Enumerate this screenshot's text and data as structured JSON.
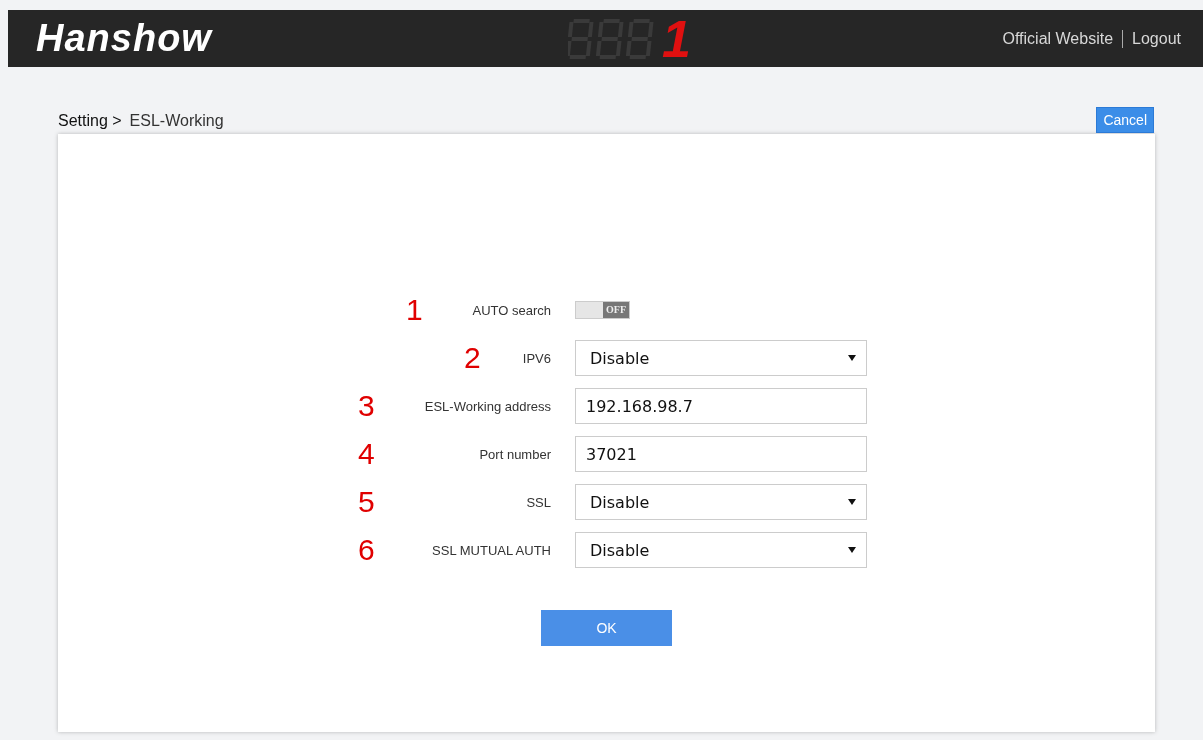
{
  "header": {
    "logo": "Hanshow",
    "display_digit": "1",
    "links": [
      "Official Website",
      "Logout"
    ]
  },
  "breadcrumb": [
    "Setting >",
    "ESL-Working"
  ],
  "cancel_button": "Cancel",
  "form": [
    {
      "marker": "1",
      "label": "AUTO search",
      "kind": "toggle",
      "on": false,
      "state_text": "OFF"
    },
    {
      "marker": "2",
      "label": "IPV6",
      "kind": "select",
      "value": "Disable"
    },
    {
      "marker": "3",
      "label": "ESL-Working address",
      "kind": "text",
      "value": "192.168.98.7"
    },
    {
      "marker": "4",
      "label": "Port number",
      "kind": "text",
      "value": "37021"
    },
    {
      "marker": "5",
      "label": "SSL",
      "kind": "select",
      "value": "Disable"
    },
    {
      "marker": "6",
      "label": "SSL MUTUAL AUTH",
      "kind": "select",
      "value": "Disable"
    }
  ],
  "ok_button": "OK"
}
